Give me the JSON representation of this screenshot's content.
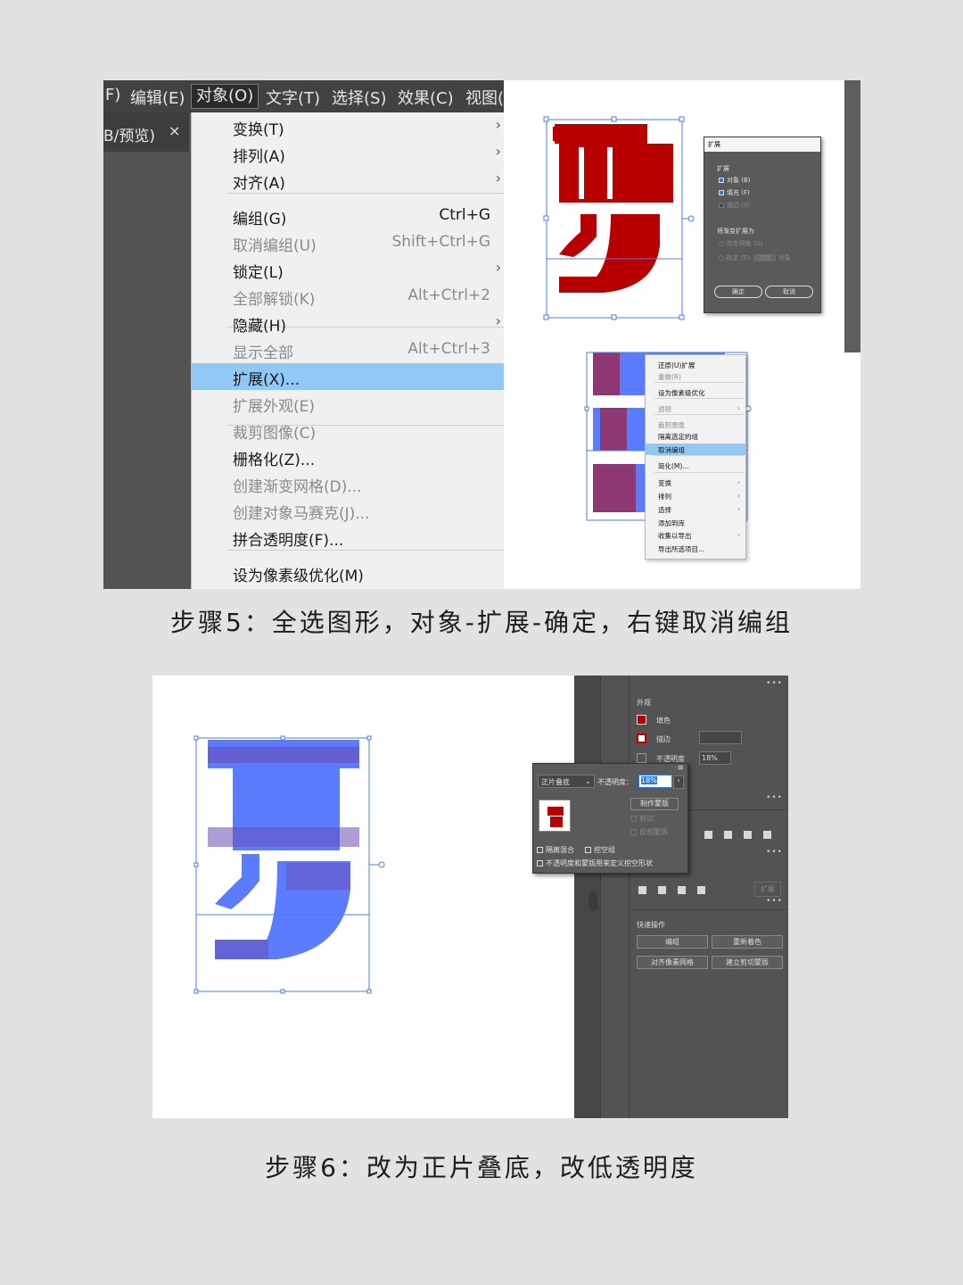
{
  "step5": {
    "menubar": [
      "F)",
      "编辑(E)",
      "对象(O)",
      "文字(T)",
      "选择(S)",
      "效果(C)",
      "视图("
    ],
    "doc_tab": "B/预览)",
    "doc_tab_close": "×",
    "menu": [
      {
        "label": "变换(T)",
        "submenu": true
      },
      {
        "label": "排列(A)",
        "submenu": true
      },
      {
        "label": "对齐(A)",
        "submenu": true
      },
      {
        "label": "编组(G)",
        "shortcut": "Ctrl+G"
      },
      {
        "label": "取消编组(U)",
        "shortcut": "Shift+Ctrl+G",
        "disabled": true
      },
      {
        "label": "锁定(L)",
        "submenu": true
      },
      {
        "label": "全部解锁(K)",
        "shortcut": "Alt+Ctrl+2",
        "disabled": true
      },
      {
        "label": "隐藏(H)",
        "submenu": true
      },
      {
        "label": "显示全部",
        "shortcut": "Alt+Ctrl+3",
        "disabled": true
      },
      {
        "label": "扩展(X)...",
        "highlighted": true
      },
      {
        "label": "扩展外观(E)",
        "disabled": true
      },
      {
        "label": "裁剪图像(C)",
        "disabled": true
      },
      {
        "label": "栅格化(Z)..."
      },
      {
        "label": "创建渐变网格(D)...",
        "disabled": true
      },
      {
        "label": "创建对象马赛克(J)...",
        "disabled": true
      },
      {
        "label": "拼合透明度(F)..."
      },
      {
        "label": "设为像素级优化(M)"
      }
    ],
    "expand_dialog": {
      "title": "扩展",
      "section": "扩展",
      "object": "对象 (B)",
      "fill": "填充 (F)",
      "stroke": "描边 (S)",
      "gradient_section": "将渐变扩展为",
      "gradient_mesh": "渐变网格 (G)",
      "specify": "指定 (S):",
      "specify_value": "255",
      "specify_unit": "对象",
      "ok": "确定",
      "cancel": "取消"
    },
    "context_menu": [
      {
        "label": "还原(U)扩展"
      },
      {
        "label": "重做(R)",
        "disabled": true
      },
      {
        "label": "设为像素级优化"
      },
      {
        "label": "透视",
        "submenu": true,
        "disabled": true
      },
      {
        "label": "裁剪图像",
        "disabled": true
      },
      {
        "label": "隔离选定的组"
      },
      {
        "label": "取消编组",
        "highlighted": true
      },
      {
        "label": "简化(M)..."
      },
      {
        "label": "变换",
        "submenu": true
      },
      {
        "label": "排列",
        "submenu": true
      },
      {
        "label": "选择",
        "submenu": true
      },
      {
        "label": "添加到库"
      },
      {
        "label": "收集以导出",
        "submenu": true
      },
      {
        "label": "导出所选项目..."
      }
    ],
    "caption": "步骤5：全选图形，对象-扩展-确定，右键取消编组"
  },
  "step6": {
    "appearance": {
      "title": "外观",
      "fill": "填色",
      "stroke": "描边",
      "opacity": "不透明度",
      "opacity_value": "18%"
    },
    "transparency_panel": {
      "blend_mode": "正片叠底",
      "opacity_label": "不透明度：",
      "opacity_value": "18%",
      "make_mask": "制作蒙版",
      "clip": "剪切",
      "invert_mask": "反相蒙版",
      "isolate_blending": "隔离混合",
      "knockout_group": "挖空组",
      "opacity_mask_knockout": "不透明度和蒙版用来定义挖空形状"
    },
    "quick_actions": {
      "title": "快速操作",
      "group": "编组",
      "recolor": "重新着色",
      "align_pixel_grid": "对齐像素网格",
      "make_clipping_mask": "建立剪切蒙版"
    },
    "expand_label": "扩展",
    "caption": "步骤6：改为正片叠底，改低透明度"
  },
  "colors": {
    "glyph_red": "#b80000",
    "glyph_blue": "#5b7cff",
    "selection_blue": "#4a7fd8",
    "menu_highlight": "#90c8f6"
  }
}
